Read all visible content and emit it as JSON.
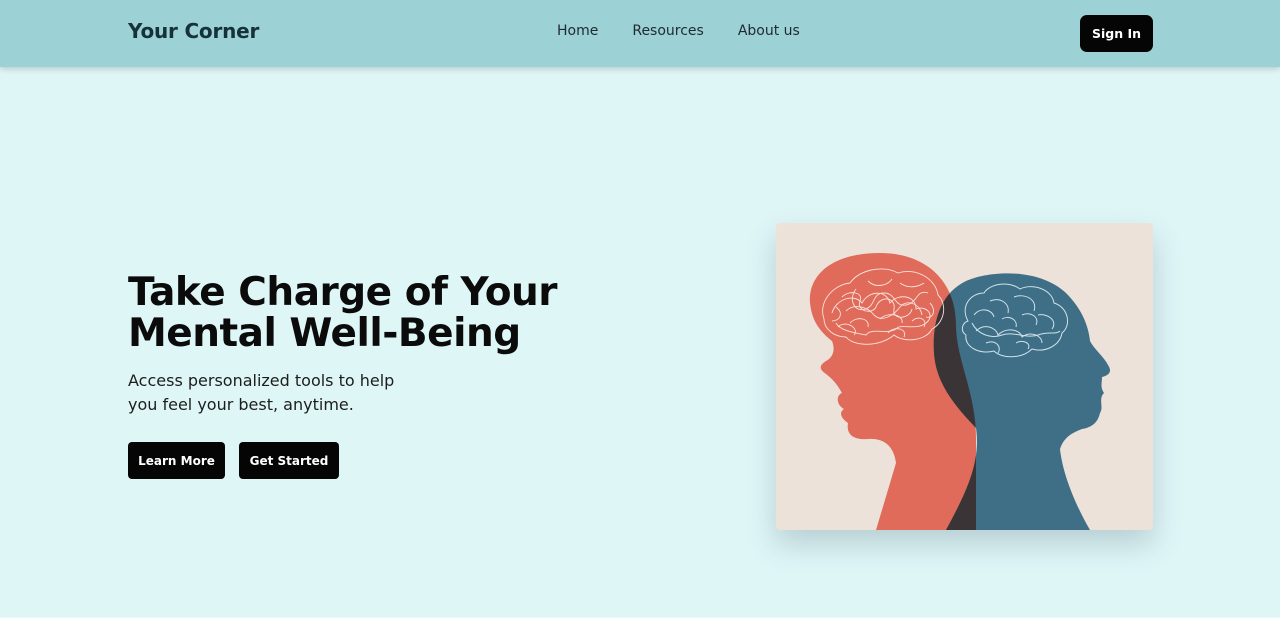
{
  "nav": {
    "logo": "Your Corner",
    "links": [
      "Home",
      "Resources",
      "About us"
    ],
    "signin_label": "Sign In"
  },
  "hero": {
    "title_line1": "Take Charge of Your",
    "title_line2": "Mental Well-Being",
    "subtitle_line1": "Access personalized tools to help",
    "subtitle_line2": "you feel your best, anytime.",
    "learn_more_label": "Learn More",
    "get_started_label": "Get Started"
  },
  "colors": {
    "page_bg": "#dff6f7",
    "navbar_bg": "#9cd2d5",
    "button_bg": "#050505",
    "illustration_bg": "#ece2da",
    "head_red": "#e06b5b",
    "head_blue": "#3e6f86",
    "overlap_dark": "#3a3436"
  }
}
